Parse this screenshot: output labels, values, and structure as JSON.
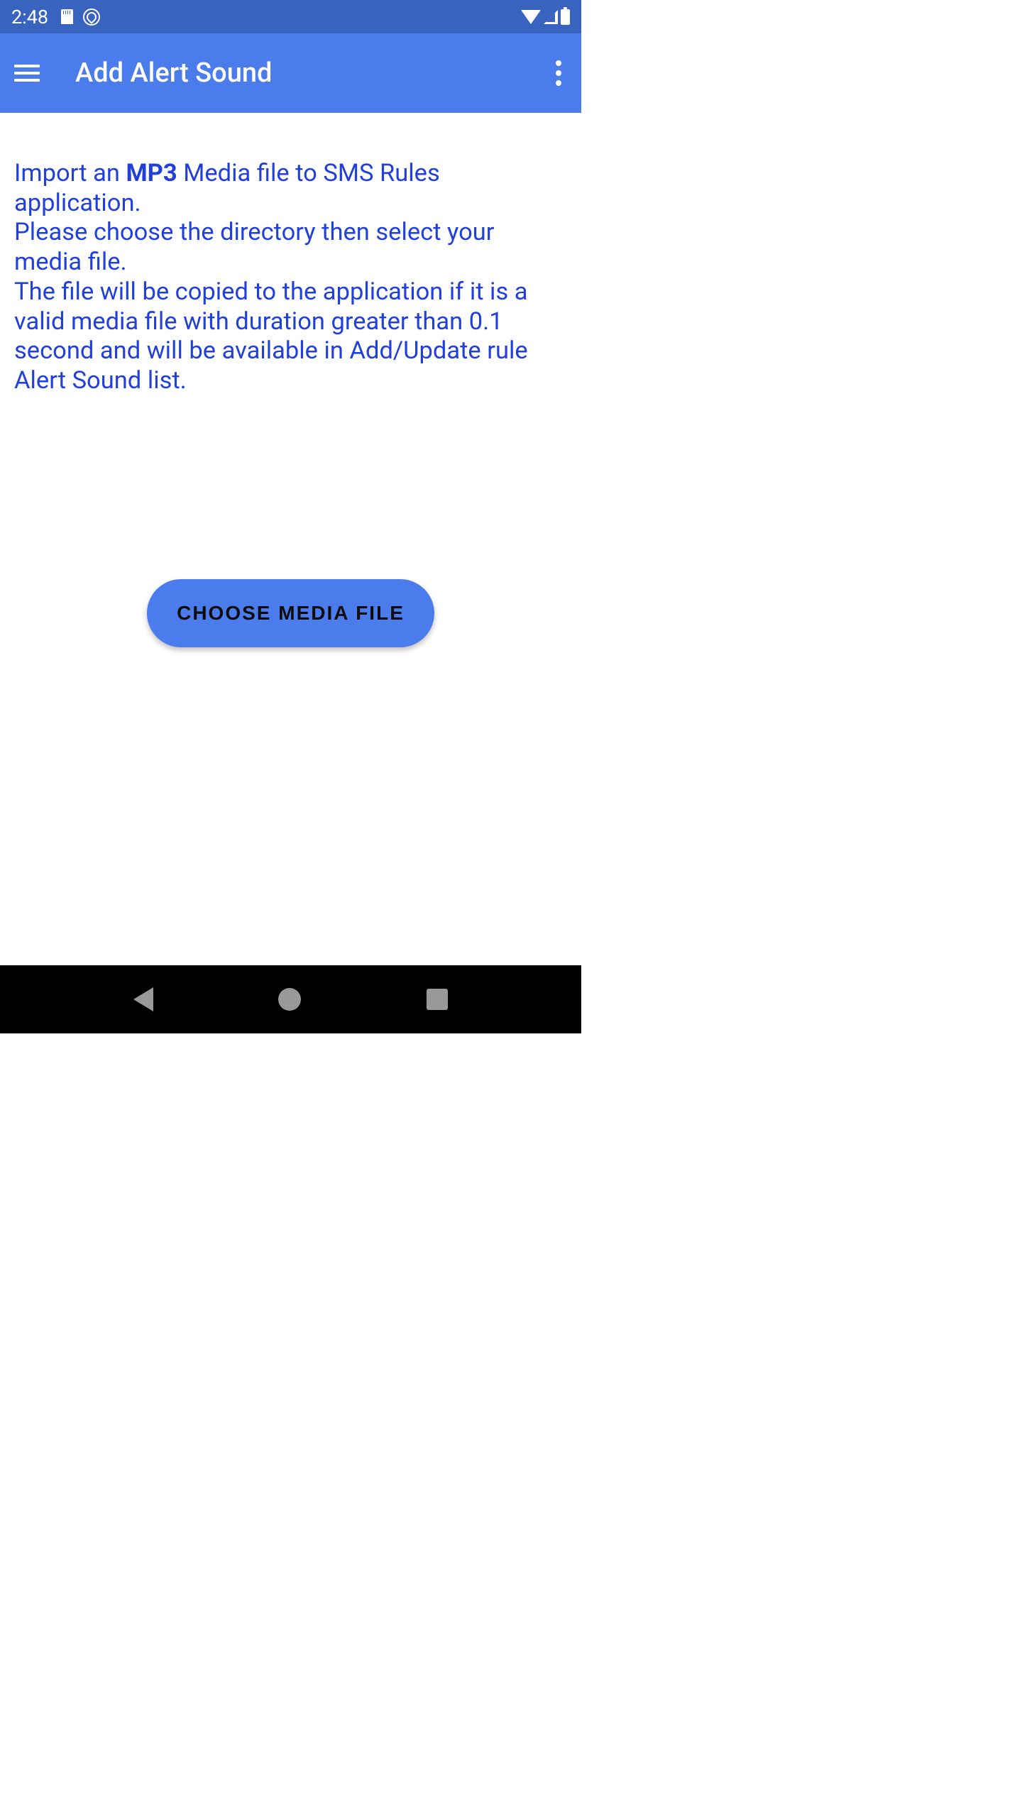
{
  "statusBar": {
    "time": "2:48"
  },
  "appBar": {
    "title": "Add Alert Sound"
  },
  "content": {
    "description_part1": "Import an ",
    "description_bold": "MP3",
    "description_part2": " Media file to SMS Rules application.",
    "description_line2": "Please choose the directory then select your media file.",
    "description_line3": "The file will be copied to the application if it is a valid media file with duration greater than 0.1 second and will be available in Add/Update rule Alert Sound list."
  },
  "button": {
    "choose_media_label": "CHOOSE MEDIA FILE"
  }
}
